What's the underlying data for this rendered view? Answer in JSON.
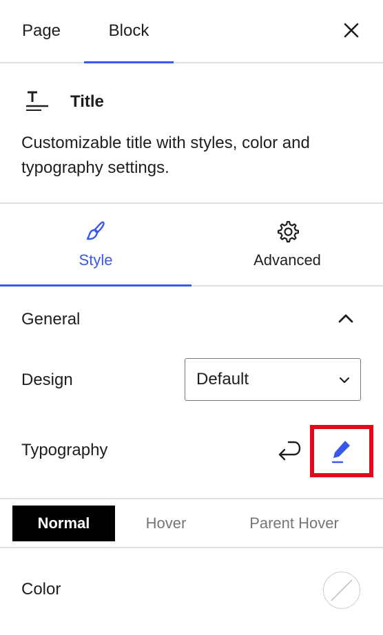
{
  "header": {
    "tabs": [
      {
        "label": "Page"
      },
      {
        "label": "Block"
      }
    ],
    "active_tab": "Block",
    "close_icon": "close-icon"
  },
  "block": {
    "icon": "title-block-icon",
    "title": "Title",
    "description": "Customizable title with styles, color and typography settings."
  },
  "panel_tabs": [
    {
      "label": "Style",
      "icon": "brush-icon"
    },
    {
      "label": "Advanced",
      "icon": "gear-icon"
    }
  ],
  "general": {
    "title": "General",
    "design_label": "Design",
    "design_value": "Default",
    "typography_label": "Typography",
    "reset_icon": "reset-arrow-icon",
    "edit_icon": "pencil-icon"
  },
  "state_tabs": [
    "Normal",
    "Hover",
    "Parent Hover"
  ],
  "color": {
    "label": "Color",
    "swatch_icon": "no-color-swatch-icon"
  },
  "colors": {
    "accent": "#3858e9",
    "highlight_border": "#e00a1a",
    "divider": "#e0e0e0",
    "text": "#1e1e1e"
  }
}
